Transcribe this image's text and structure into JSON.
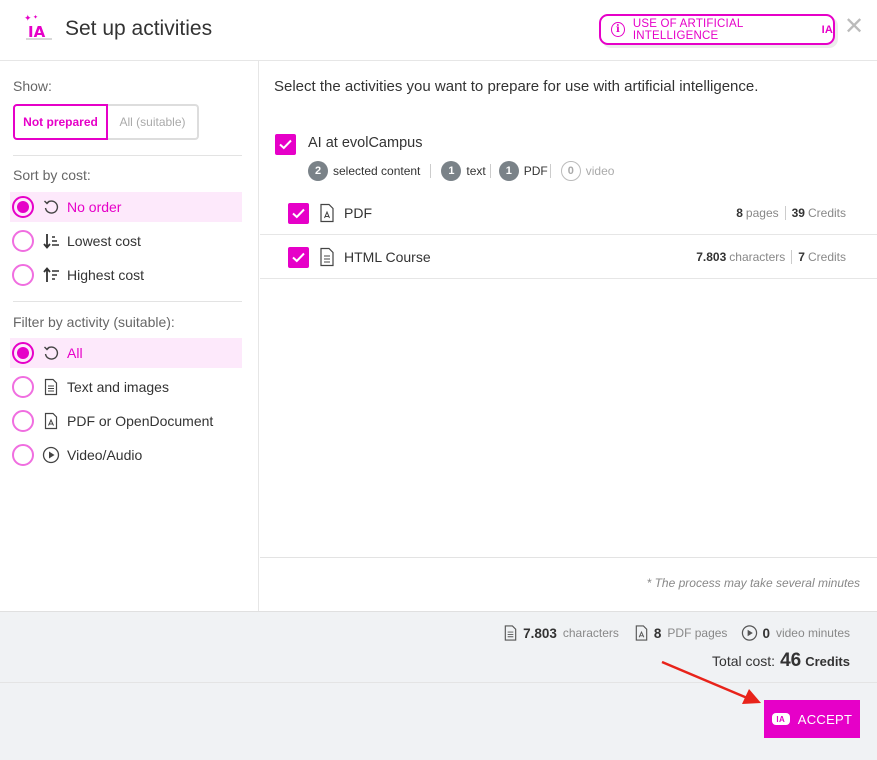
{
  "header": {
    "title": "Set up activities",
    "ai_button_label": "USE OF ARTIFICIAL INTELLIGENCE",
    "ai_badge": "IA",
    "close_symbol": "✕"
  },
  "sidebar": {
    "show_label": "Show:",
    "show_options": [
      "Not prepared",
      "All (suitable)"
    ],
    "sort_label": "Sort by cost:",
    "sort_options": [
      "No order",
      "Lowest cost",
      "Highest cost"
    ],
    "filter_label": "Filter by activity (suitable):",
    "filter_options": [
      "All",
      "Text and images",
      "PDF or OpenDocument",
      "Video/Audio"
    ]
  },
  "main": {
    "intro": "Select the activities you want to prepare for use with artificial intelligence.",
    "group": {
      "title": "AI at evolCampus",
      "selected_count": "2",
      "selected_label": "selected content",
      "text_count": "1",
      "text_label": "text",
      "pdf_count": "1",
      "pdf_label": "PDF",
      "video_count": "0",
      "video_label": "video"
    },
    "items": [
      {
        "name": "PDF",
        "amount": "8",
        "unit": "pages",
        "credits": "39",
        "credits_label": "Credits"
      },
      {
        "name": "HTML Course",
        "amount": "7.803",
        "unit": "characters",
        "credits": "7",
        "credits_label": "Credits"
      }
    ],
    "note": "* The process may take several minutes"
  },
  "summary": {
    "characters_value": "7.803",
    "characters_label": "characters",
    "pdf_value": "8",
    "pdf_label": "PDF pages",
    "video_value": "0",
    "video_label": "video minutes",
    "total_label": "Total cost:",
    "total_value": "46",
    "total_unit": "Credits"
  },
  "footer": {
    "accept_label": "ACCEPT",
    "accept_badge": "IA"
  },
  "colors": {
    "accent": "#e600c8",
    "selected_bg": "#fde9fb",
    "footer_bg": "#f0f2f4",
    "arrow": "#e8231a"
  }
}
